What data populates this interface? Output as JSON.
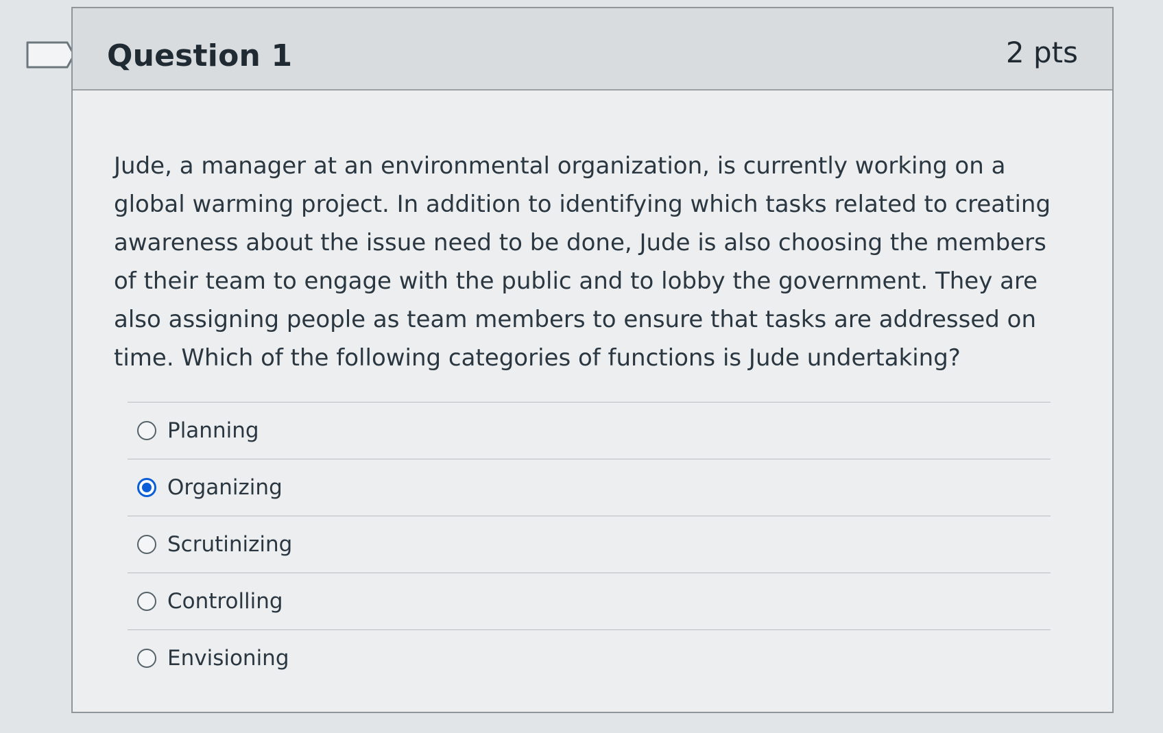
{
  "question": {
    "title": "Question 1",
    "points": "2 pts",
    "text": "Jude, a manager at an environmental organization, is currently working on a global warming project. In addition to identifying which tasks related to creating awareness about the issue need to be done, Jude is also choosing the members of their team to engage with the public and to lobby the government. They are also assigning people as team members to ensure that tasks are addressed on time. Which of the following categories of functions is Jude undertaking?",
    "answers": [
      {
        "label": "Planning",
        "selected": false
      },
      {
        "label": "Organizing",
        "selected": true
      },
      {
        "label": "Scrutinizing",
        "selected": false
      },
      {
        "label": "Controlling",
        "selected": false
      },
      {
        "label": "Envisioning",
        "selected": false
      }
    ]
  },
  "colors": {
    "selected_radio": "#0b5ed8",
    "header_background": "#d8dcdf"
  },
  "icons": {
    "flag": "flag-question-icon"
  }
}
